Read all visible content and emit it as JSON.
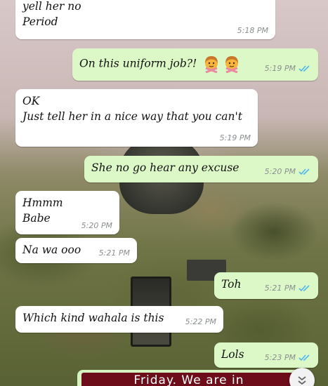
{
  "messages": [
    {
      "direction": "in",
      "text": "yell her no\nPeriod",
      "time": "5:18 PM"
    },
    {
      "direction": "out",
      "text": "On this uniform job?!",
      "emoji": [
        "woman-gesturing-no",
        "woman-gesturing-no"
      ],
      "time": "5:19 PM",
      "status": "read"
    },
    {
      "direction": "in",
      "text": "OK\nJust tell her in a nice way that you can't",
      "time": "5:19 PM"
    },
    {
      "direction": "out",
      "text": "She no go hear any excuse",
      "time": "5:20 PM",
      "status": "read"
    },
    {
      "direction": "in",
      "text": "Hmmm\nBabe",
      "time": "5:20 PM"
    },
    {
      "direction": "in",
      "text": "Na wa ooo",
      "time": "5:21 PM"
    },
    {
      "direction": "out",
      "text": "Toh",
      "time": "5:21 PM",
      "status": "read"
    },
    {
      "direction": "in",
      "text": "Which kind wahala is this",
      "time": "5:22 PM"
    },
    {
      "direction": "out",
      "text": "Lols",
      "time": "5:23 PM",
      "status": "read"
    }
  ],
  "partial_message": {
    "text": "Friday. We are in"
  },
  "colors": {
    "incoming": "#ffffff",
    "outgoing": "#dcf8c6",
    "read_ticks": "#4fb6ec",
    "banner": "#6d0d1a"
  },
  "scroll_button_icon": "double-chevron-down-icon"
}
